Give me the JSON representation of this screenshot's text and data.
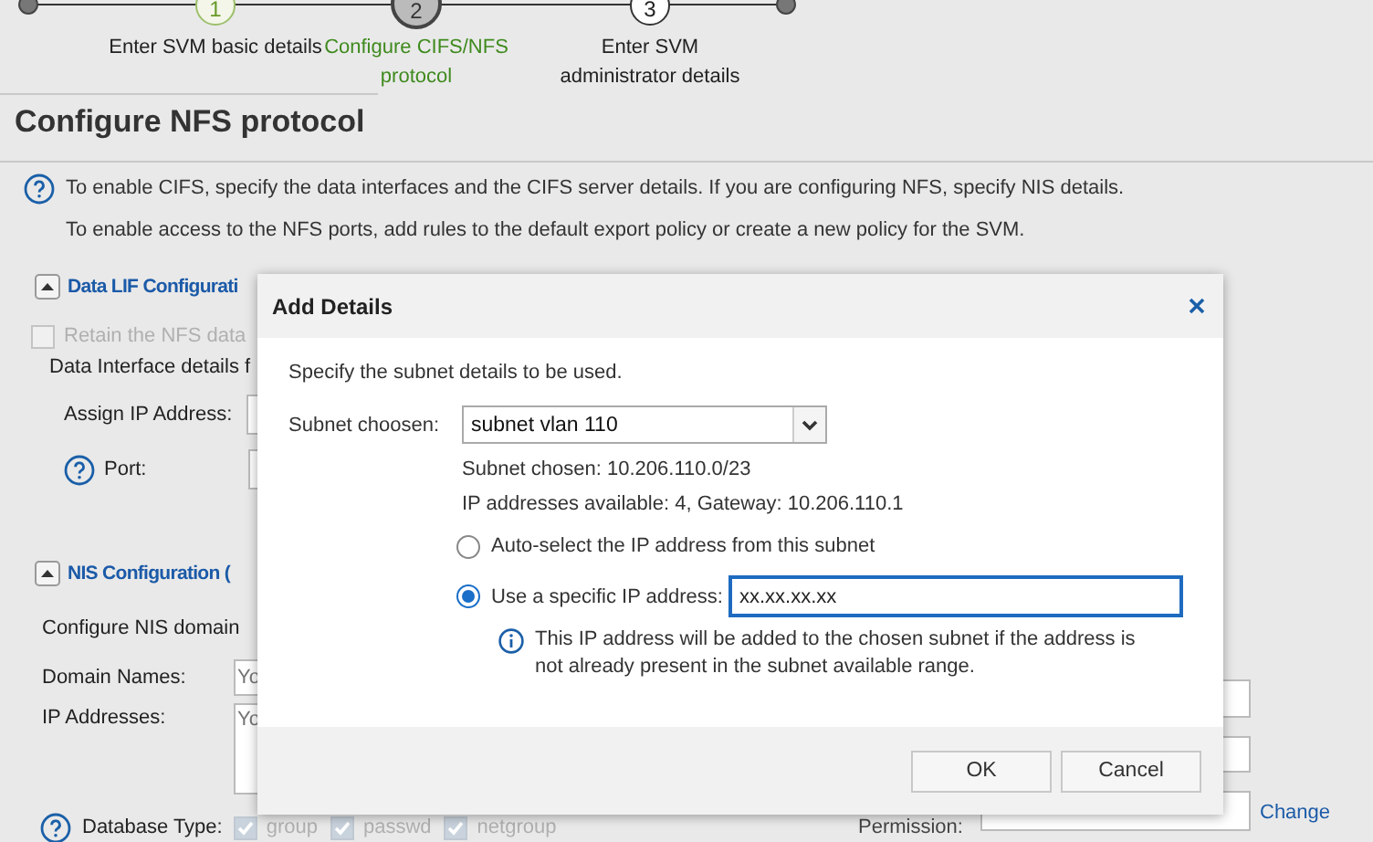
{
  "steps": [
    {
      "number": "1",
      "label": "Enter SVM basic details",
      "done": true,
      "selected": false
    },
    {
      "number": "2",
      "label": "Configure CIFS/NFS protocol",
      "done": false,
      "selected": true
    },
    {
      "number": "3",
      "label": "Enter SVM administrator details",
      "done": false,
      "selected": false
    }
  ],
  "page_title": "Configure NFS protocol",
  "info_lines": [
    "To enable CIFS, specify the data interfaces and the CIFS server details. If you are configuring NFS, specify NIS details.",
    "To enable access to the NFS ports, add rules to the default export policy or create a new policy for the SVM."
  ],
  "data_lif": {
    "title": "Data LIF Configurati",
    "expanded": true,
    "retain": {
      "label": "Retain the NFS data",
      "checked": false,
      "disabled": true
    },
    "details_text": "Data Interface details f",
    "assign_label": "Assign IP Address:",
    "port_label": "Port:"
  },
  "nis": {
    "title": "NIS Configuration (",
    "expanded": true,
    "description": "Configure NIS domain",
    "domain_label": "Domain Names:",
    "domain_placeholder": "Yo",
    "ip_label": "IP Addresses:",
    "ip_placeholder": "Yo",
    "database_label": "Database Type:",
    "database_types": [
      {
        "label": "group",
        "checked": true,
        "disabled": true
      },
      {
        "label": "passwd",
        "checked": true,
        "disabled": true
      },
      {
        "label": "netgroup",
        "checked": true,
        "disabled": true
      }
    ],
    "permission_label": "Permission:",
    "change_link": "Change"
  },
  "dialog": {
    "title": "Add Details",
    "intro": "Specify the subnet details to be used.",
    "subnet_label": "Subnet choosen:",
    "subnet_value": "subnet vlan 110",
    "subnet_info": "Subnet chosen: 10.206.110.0/23",
    "availability": "IP addresses available: 4, Gateway: 10.206.110.1",
    "options": [
      {
        "kind": "radio",
        "label": "Auto-select the IP address from this subnet",
        "selected": false
      },
      {
        "kind": "radio_input",
        "label": "Use a specific IP address:",
        "selected": true,
        "value": "xx.xx.xx.xx",
        "note": "This IP address will be added to the chosen subnet if the address is not already present in the subnet available range."
      }
    ],
    "buttons": [
      "OK",
      "Cancel"
    ]
  }
}
